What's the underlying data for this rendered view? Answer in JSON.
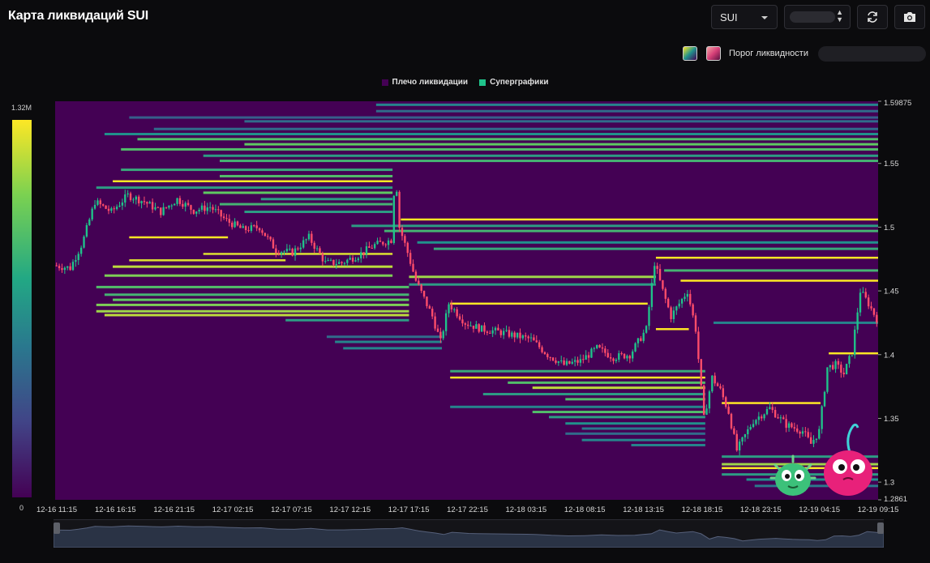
{
  "header": {
    "title": "Карта ликвидаций SUI"
  },
  "toolbar": {
    "symbol_select": {
      "value": "SUI",
      "icon": "chevron-down-icon"
    },
    "range_select": {
      "value": "",
      "icon": "updown-icon"
    },
    "refresh_icon": "refresh-icon",
    "screenshot_icon": "camera-icon"
  },
  "threshold": {
    "label": "Порог ликвидности",
    "value": ""
  },
  "legend": [
    {
      "label": "Плечо ликвидации",
      "color": "#440154"
    },
    {
      "label": "Суперграфики",
      "color": "#1fc38a"
    }
  ],
  "colorbar": {
    "max_label": "1.32M",
    "min_label": "0"
  },
  "chart_data": {
    "type": "heatmap",
    "title": "",
    "y_axis": {
      "ticks": [
        "1.59875",
        "1.55",
        "1.5",
        "1.45",
        "1.4",
        "1.35",
        "1.3",
        "1.2861"
      ],
      "min": 1.2861,
      "max": 1.59875
    },
    "x_axis": {
      "ticks": [
        "12-16 11:15",
        "12-16 16:15",
        "12-16 21:15",
        "12-17 02:15",
        "12-17 07:15",
        "12-17 12:15",
        "12-17 17:15",
        "12-17 22:15",
        "12-18 03:15",
        "12-18 08:15",
        "12-18 13:15",
        "12-18 18:15",
        "12-18 23:15",
        "12-19 04:15",
        "12-19 09:15"
      ]
    },
    "price_anchors": [
      {
        "t": 0.0,
        "p": 1.47
      },
      {
        "t": 0.02,
        "p": 1.468
      },
      {
        "t": 0.035,
        "p": 1.488
      },
      {
        "t": 0.05,
        "p": 1.52
      },
      {
        "t": 0.07,
        "p": 1.512
      },
      {
        "t": 0.09,
        "p": 1.525
      },
      {
        "t": 0.11,
        "p": 1.52
      },
      {
        "t": 0.13,
        "p": 1.512
      },
      {
        "t": 0.15,
        "p": 1.522
      },
      {
        "t": 0.17,
        "p": 1.513
      },
      {
        "t": 0.19,
        "p": 1.516
      },
      {
        "t": 0.21,
        "p": 1.505
      },
      {
        "t": 0.23,
        "p": 1.498
      },
      {
        "t": 0.25,
        "p": 1.5
      },
      {
        "t": 0.27,
        "p": 1.482
      },
      {
        "t": 0.29,
        "p": 1.48
      },
      {
        "t": 0.31,
        "p": 1.492
      },
      {
        "t": 0.33,
        "p": 1.472
      },
      {
        "t": 0.35,
        "p": 1.472
      },
      {
        "t": 0.37,
        "p": 1.478
      },
      {
        "t": 0.39,
        "p": 1.486
      },
      {
        "t": 0.41,
        "p": 1.49
      },
      {
        "t": 0.415,
        "p": 1.545
      },
      {
        "t": 0.42,
        "p": 1.5
      },
      {
        "t": 0.43,
        "p": 1.48
      },
      {
        "t": 0.44,
        "p": 1.458
      },
      {
        "t": 0.46,
        "p": 1.43
      },
      {
        "t": 0.47,
        "p": 1.41
      },
      {
        "t": 0.48,
        "p": 1.44
      },
      {
        "t": 0.5,
        "p": 1.425
      },
      {
        "t": 0.52,
        "p": 1.42
      },
      {
        "t": 0.54,
        "p": 1.418
      },
      {
        "t": 0.56,
        "p": 1.415
      },
      {
        "t": 0.58,
        "p": 1.412
      },
      {
        "t": 0.6,
        "p": 1.4
      },
      {
        "t": 0.62,
        "p": 1.392
      },
      {
        "t": 0.64,
        "p": 1.395
      },
      {
        "t": 0.66,
        "p": 1.405
      },
      {
        "t": 0.68,
        "p": 1.398
      },
      {
        "t": 0.7,
        "p": 1.4
      },
      {
        "t": 0.72,
        "p": 1.42
      },
      {
        "t": 0.73,
        "p": 1.472
      },
      {
        "t": 0.74,
        "p": 1.45
      },
      {
        "t": 0.75,
        "p": 1.43
      },
      {
        "t": 0.77,
        "p": 1.45
      },
      {
        "t": 0.78,
        "p": 1.42
      },
      {
        "t": 0.79,
        "p": 1.35
      },
      {
        "t": 0.8,
        "p": 1.382
      },
      {
        "t": 0.81,
        "p": 1.372
      },
      {
        "t": 0.82,
        "p": 1.355
      },
      {
        "t": 0.83,
        "p": 1.325
      },
      {
        "t": 0.85,
        "p": 1.348
      },
      {
        "t": 0.87,
        "p": 1.358
      },
      {
        "t": 0.89,
        "p": 1.345
      },
      {
        "t": 0.91,
        "p": 1.34
      },
      {
        "t": 0.92,
        "p": 1.33
      },
      {
        "t": 0.93,
        "p": 1.34
      },
      {
        "t": 0.94,
        "p": 1.39
      },
      {
        "t": 0.95,
        "p": 1.392
      },
      {
        "t": 0.96,
        "p": 1.385
      },
      {
        "t": 0.97,
        "p": 1.402
      },
      {
        "t": 0.98,
        "p": 1.45
      },
      {
        "t": 0.99,
        "p": 1.44
      },
      {
        "t": 1.0,
        "p": 1.428
      }
    ],
    "liquidity_levels": [
      {
        "p": 1.596,
        "t0": 0.39,
        "i": 0.45
      },
      {
        "p": 1.591,
        "t0": 0.39,
        "i": 0.35
      },
      {
        "p": 1.586,
        "t0": 0.09,
        "i": 0.3
      },
      {
        "p": 1.583,
        "t0": 0.23,
        "i": 0.35
      },
      {
        "p": 1.577,
        "t0": 0.12,
        "i": 0.35
      },
      {
        "p": 1.573,
        "t0": 0.06,
        "i": 0.5
      },
      {
        "p": 1.569,
        "t0": 0.1,
        "i": 0.7
      },
      {
        "p": 1.565,
        "t0": 0.23,
        "i": 0.75
      },
      {
        "p": 1.561,
        "t0": 0.08,
        "i": 0.7
      },
      {
        "p": 1.556,
        "t0": 0.18,
        "i": 0.55
      },
      {
        "p": 1.552,
        "t0": 0.2,
        "i": 0.65
      },
      {
        "p": 1.545,
        "t0": 0.08,
        "i": 0.6,
        "t1": 0.41
      },
      {
        "p": 1.54,
        "t0": 0.2,
        "i": 0.7,
        "t1": 0.41
      },
      {
        "p": 1.536,
        "t0": 0.07,
        "i": 1.0,
        "t1": 0.41
      },
      {
        "p": 1.531,
        "t0": 0.05,
        "i": 0.55,
        "t1": 0.41
      },
      {
        "p": 1.527,
        "t0": 0.18,
        "i": 0.75,
        "t1": 0.41
      },
      {
        "p": 1.522,
        "t0": 0.25,
        "i": 0.55,
        "t1": 0.41
      },
      {
        "p": 1.518,
        "t0": 0.2,
        "i": 0.65,
        "t1": 0.41
      },
      {
        "p": 1.512,
        "t0": 0.23,
        "i": 0.55,
        "t1": 0.41
      },
      {
        "p": 1.506,
        "t0": 0.42,
        "i": 1.0
      },
      {
        "p": 1.501,
        "t0": 0.36,
        "i": 0.55
      },
      {
        "p": 1.497,
        "t0": 0.4,
        "i": 0.65
      },
      {
        "p": 1.492,
        "t0": 0.09,
        "i": 1.0,
        "t1": 0.21
      },
      {
        "p": 1.488,
        "t0": 0.44,
        "i": 0.5
      },
      {
        "p": 1.483,
        "t0": 0.46,
        "i": 0.6
      },
      {
        "p": 1.479,
        "t0": 0.18,
        "i": 0.95,
        "t1": 0.41
      },
      {
        "p": 1.476,
        "t0": 0.73,
        "i": 1.0
      },
      {
        "p": 1.474,
        "t0": 0.09,
        "i": 0.95,
        "t1": 0.28
      },
      {
        "p": 1.469,
        "t0": 0.07,
        "i": 0.9,
        "t1": 0.41
      },
      {
        "p": 1.466,
        "t0": 0.74,
        "i": 0.65
      },
      {
        "p": 1.462,
        "t0": 0.06,
        "i": 0.8,
        "t1": 0.41
      },
      {
        "p": 1.461,
        "t0": 0.43,
        "i": 0.85,
        "t1": 0.73
      },
      {
        "p": 1.458,
        "t0": 0.76,
        "i": 1.0
      },
      {
        "p": 1.453,
        "t0": 0.05,
        "i": 0.7,
        "t1": 0.43
      },
      {
        "p": 1.455,
        "t0": 0.43,
        "i": 0.55,
        "t1": 0.73
      },
      {
        "p": 1.447,
        "t0": 0.06,
        "i": 0.65,
        "t1": 0.43
      },
      {
        "p": 1.443,
        "t0": 0.07,
        "i": 0.75,
        "t1": 0.43
      },
      {
        "p": 1.439,
        "t0": 0.05,
        "i": 0.8,
        "t1": 0.43
      },
      {
        "p": 1.44,
        "t0": 0.48,
        "i": 1.0,
        "t1": 0.72
      },
      {
        "p": 1.434,
        "t0": 0.05,
        "i": 0.85,
        "t1": 0.43
      },
      {
        "p": 1.431,
        "t0": 0.06,
        "i": 0.9,
        "t1": 0.43
      },
      {
        "p": 1.427,
        "t0": 0.28,
        "i": 0.55,
        "t1": 0.43
      },
      {
        "p": 1.425,
        "t0": 0.8,
        "i": 0.45
      },
      {
        "p": 1.42,
        "t0": 0.73,
        "i": 1.0,
        "t1": 0.77
      },
      {
        "p": 1.414,
        "t0": 0.33,
        "i": 0.35,
        "t1": 0.47
      },
      {
        "p": 1.41,
        "t0": 0.34,
        "i": 0.45,
        "t1": 0.47
      },
      {
        "p": 1.405,
        "t0": 0.35,
        "i": 0.45,
        "t1": 0.47
      },
      {
        "p": 1.401,
        "t0": 0.94,
        "i": 1.0
      },
      {
        "p": 1.387,
        "t0": 0.48,
        "i": 0.6,
        "t1": 0.79
      },
      {
        "p": 1.382,
        "t0": 0.48,
        "i": 1.0,
        "t1": 0.79
      },
      {
        "p": 1.378,
        "t0": 0.55,
        "i": 0.7,
        "t1": 0.79
      },
      {
        "p": 1.374,
        "t0": 0.58,
        "i": 0.9,
        "t1": 0.79
      },
      {
        "p": 1.369,
        "t0": 0.52,
        "i": 0.55,
        "t1": 0.79
      },
      {
        "p": 1.365,
        "t0": 0.62,
        "i": 0.7,
        "t1": 0.79
      },
      {
        "p": 1.362,
        "t0": 0.81,
        "i": 1.0,
        "t1": 0.93
      },
      {
        "p": 1.359,
        "t0": 0.48,
        "i": 0.45,
        "t1": 0.79
      },
      {
        "p": 1.355,
        "t0": 0.58,
        "i": 0.7,
        "t1": 0.79
      },
      {
        "p": 1.351,
        "t0": 0.6,
        "i": 0.55,
        "t1": 0.79
      },
      {
        "p": 1.346,
        "t0": 0.62,
        "i": 0.5,
        "t1": 0.79
      },
      {
        "p": 1.342,
        "t0": 0.64,
        "i": 0.4,
        "t1": 0.79
      },
      {
        "p": 1.338,
        "t0": 0.62,
        "i": 0.35,
        "t1": 0.79
      },
      {
        "p": 1.333,
        "t0": 0.64,
        "i": 0.45,
        "t1": 0.79
      },
      {
        "p": 1.329,
        "t0": 0.7,
        "i": 0.45,
        "t1": 0.79
      },
      {
        "p": 1.32,
        "t0": 0.81,
        "i": 0.55
      },
      {
        "p": 1.314,
        "t0": 0.81,
        "i": 0.85
      },
      {
        "p": 1.311,
        "t0": 0.81,
        "i": 1.0
      },
      {
        "p": 1.306,
        "t0": 0.81,
        "i": 0.55
      },
      {
        "p": 1.302,
        "t0": 0.84,
        "i": 0.5
      },
      {
        "p": 1.297,
        "t0": 0.85,
        "i": 0.4
      }
    ]
  }
}
